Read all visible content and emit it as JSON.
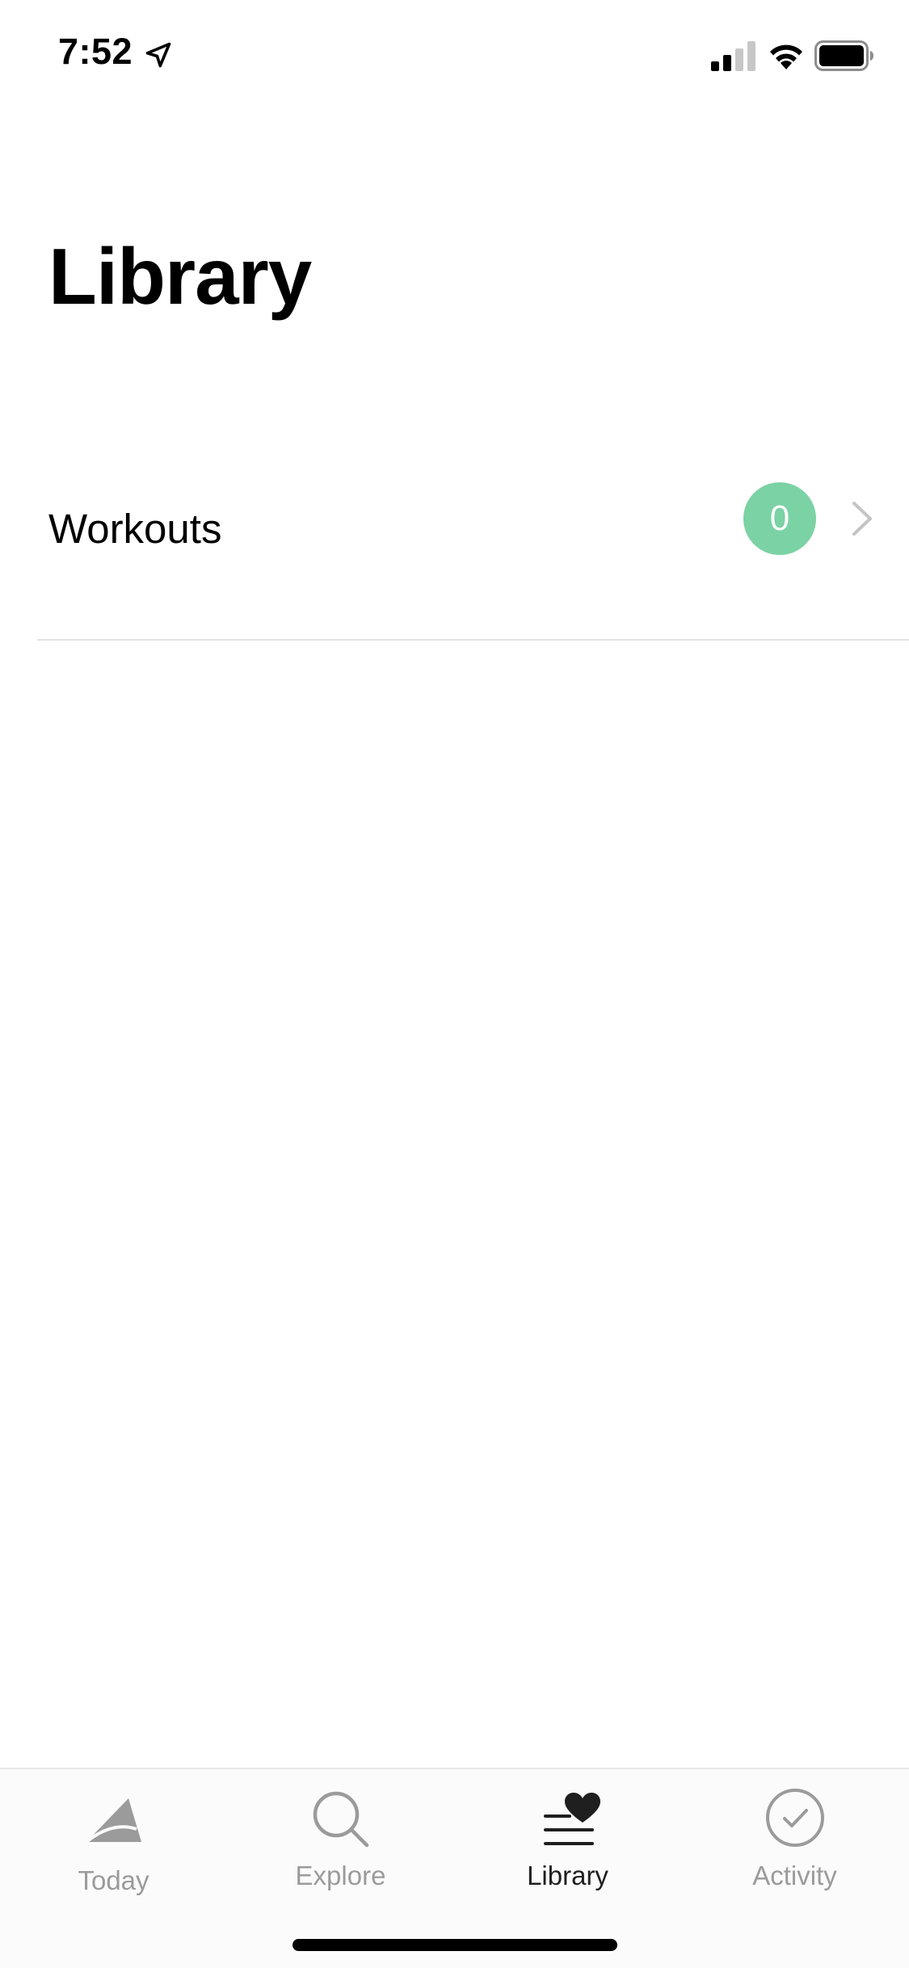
{
  "status_bar": {
    "time": "7:52",
    "location_icon": "location-arrow-icon",
    "signal_icon": "cellular-signal-icon",
    "wifi_icon": "wifi-icon",
    "battery_icon": "battery-icon"
  },
  "page": {
    "title": "Library"
  },
  "library_items": [
    {
      "label": "Workouts",
      "count": "0",
      "icon": "chevron-right-icon"
    }
  ],
  "tab_bar": {
    "tabs": [
      {
        "label": "Today",
        "icon": "today-mountain-icon",
        "active": false
      },
      {
        "label": "Explore",
        "icon": "search-icon",
        "active": false
      },
      {
        "label": "Library",
        "icon": "library-heart-icon",
        "active": true
      },
      {
        "label": "Activity",
        "icon": "check-circle-icon",
        "active": false
      }
    ]
  },
  "colors": {
    "badge": "#7bd2a4",
    "text": "#000000",
    "inactive_tab": "#9b9b9b",
    "active_tab": "#1f1f1f",
    "chevron": "#c4c4c4",
    "divider": "#e3e3e3",
    "signal_inactive": "#c7c7c7"
  }
}
